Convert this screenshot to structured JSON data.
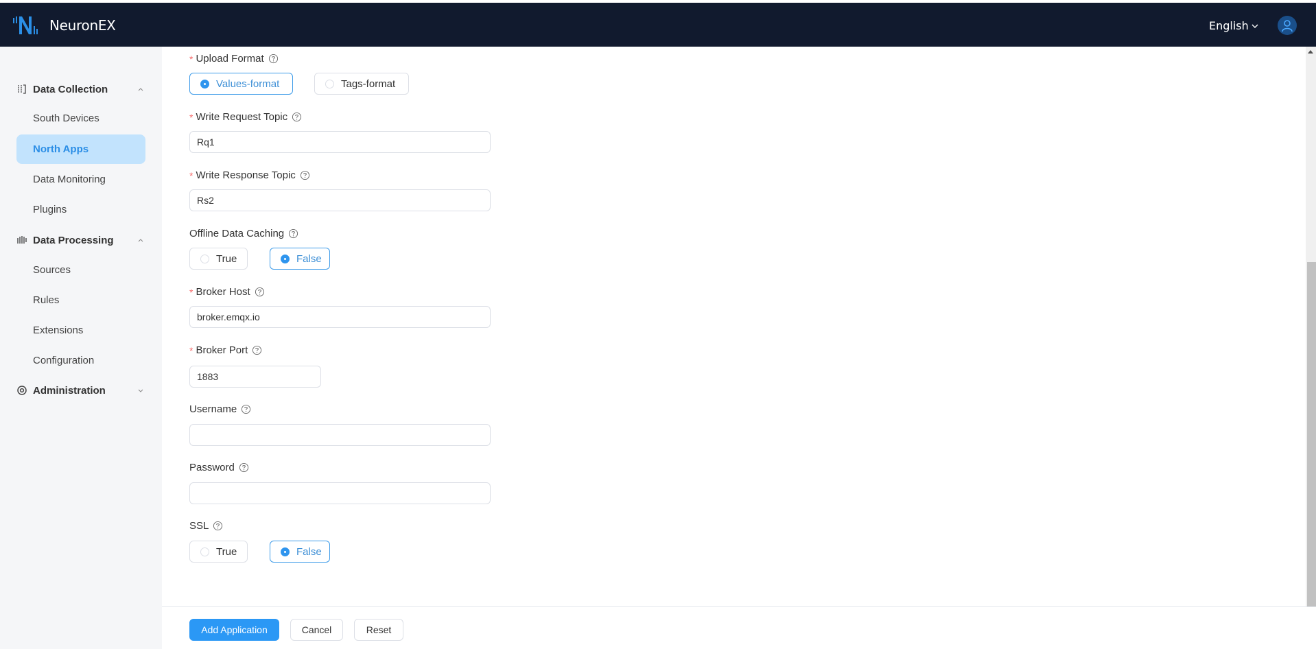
{
  "header": {
    "app_name": "NeuronEX",
    "language": "English"
  },
  "sidebar": {
    "groups": [
      {
        "label": "Data Collection",
        "icon": "list-icon",
        "expanded": true,
        "items": [
          "South Devices",
          "North Apps",
          "Data Monitoring",
          "Plugins"
        ]
      },
      {
        "label": "Data Processing",
        "icon": "bars-icon",
        "expanded": true,
        "items": [
          "Sources",
          "Rules",
          "Extensions",
          "Configuration"
        ]
      },
      {
        "label": "Administration",
        "icon": "gear-icon",
        "expanded": false,
        "items": []
      }
    ],
    "active_item": "North Apps"
  },
  "form": {
    "upload_format": {
      "label": "Upload Format",
      "required": true,
      "options": [
        "Values-format",
        "Tags-format"
      ],
      "selected": "Values-format"
    },
    "write_request_topic": {
      "label": "Write Request Topic",
      "required": true,
      "value": "Rq1"
    },
    "write_response_topic": {
      "label": "Write Response Topic",
      "required": true,
      "value": "Rs2"
    },
    "offline_data_caching": {
      "label": "Offline Data Caching",
      "required": false,
      "options": [
        "True",
        "False"
      ],
      "selected": "False"
    },
    "broker_host": {
      "label": "Broker Host",
      "required": true,
      "value": "broker.emqx.io"
    },
    "broker_port": {
      "label": "Broker Port",
      "required": true,
      "value": "1883"
    },
    "username": {
      "label": "Username",
      "required": false,
      "value": ""
    },
    "password": {
      "label": "Password",
      "required": false,
      "value": ""
    },
    "ssl": {
      "label": "SSL",
      "required": false,
      "options": [
        "True",
        "False"
      ],
      "selected": "False"
    }
  },
  "footer": {
    "add_label": "Add Application",
    "cancel_label": "Cancel",
    "reset_label": "Reset"
  },
  "colors": {
    "header_bg": "#111a2e",
    "accent": "#2b98f5",
    "active_nav_bg": "#c2e3fd",
    "required": "#f56c6c"
  }
}
